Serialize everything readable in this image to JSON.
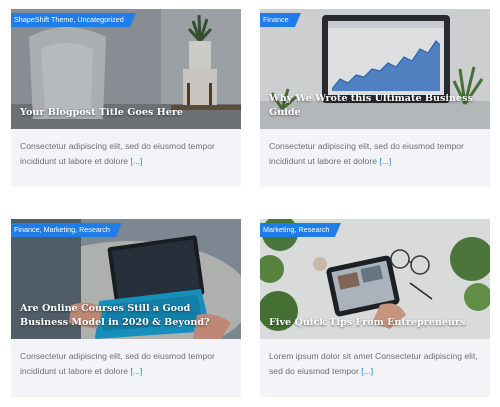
{
  "posts": [
    {
      "categories": "ShapeShift Theme, Uncategorized",
      "title": "Your Blogpost Title Goes Here",
      "excerpt": "Consectetur adipiscing elit, sed do eiusmod tempor incididunt ut labore et dolore",
      "more": "[...]"
    },
    {
      "categories": "Finance",
      "title": "Why We Wrote this Ultimate Business Guide",
      "excerpt": "Consectetur adipiscing elit, sed do eiusmod tempor incididunt ut labore et dolore",
      "more": "[...]"
    },
    {
      "categories": "Finance, Marketing, Research",
      "title": "Are Online Courses Still a Good Business Model in 2020 & Beyond?",
      "excerpt": "Consectetur adipiscing elit, sed do eiusmod tempor incididunt ut labore et dolore",
      "more": "[...]"
    },
    {
      "categories": "Marketing, Research",
      "title": "Five Quick Tips From Entrepreneurs",
      "excerpt": "Lorem ipsum dolor sit amet Consectetur adipiscing elit, sed do eiusmod tempor",
      "more": "[...]"
    }
  ],
  "colors": {
    "accent": "#1f7ce8",
    "card_background": "#f3f4f7",
    "excerpt_text": "#6d6f76",
    "link": "#2b7fd8"
  }
}
